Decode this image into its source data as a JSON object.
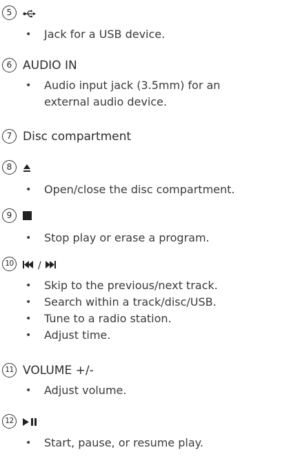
{
  "items": [
    {
      "number": "5",
      "icon": "usb-icon",
      "bullets": [
        "Jack for a USB device."
      ]
    },
    {
      "number": "6",
      "title": "AUDIO IN",
      "bullets": [
        "Audio input jack (3.5mm) for an",
        "external audio device."
      ]
    },
    {
      "number": "7",
      "title": "Disc compartment",
      "bullets": []
    },
    {
      "number": "8",
      "icon": "eject-icon",
      "bullets": [
        "Open/close the disc compartment."
      ]
    },
    {
      "number": "9",
      "icon": "stop-icon",
      "bullets": [
        "Stop play or erase a program."
      ]
    },
    {
      "number": "10",
      "icon": "prev-next-icon",
      "icon_text": "/",
      "bullets": [
        "Skip to the previous/next track.",
        "Search within a track/disc/USB.",
        "Tune to a radio station.",
        "Adjust time."
      ]
    },
    {
      "number": "11",
      "title": "VOLUME +/-",
      "bullets": [
        "Adjust volume."
      ]
    },
    {
      "number": "12",
      "icon": "play-pause-icon",
      "bullets": [
        "Start, pause, or resume play."
      ]
    }
  ],
  "colors": {
    "text": "#2b2b2b",
    "icon": "#222222"
  }
}
